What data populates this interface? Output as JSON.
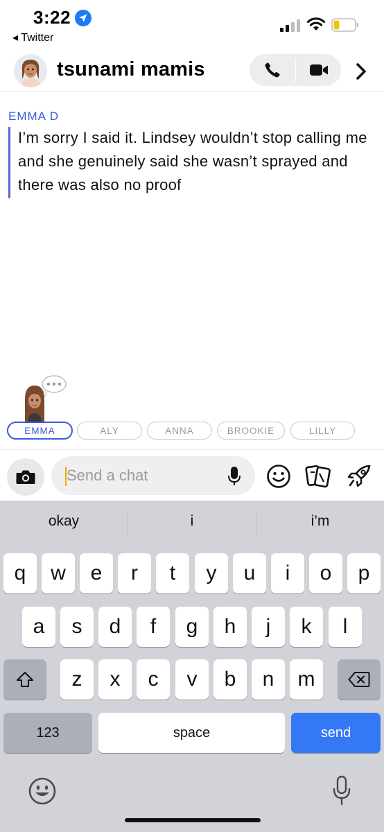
{
  "status_bar": {
    "time": "3:22",
    "back_app": "Twitter"
  },
  "header": {
    "title": "tsunami mamis"
  },
  "message": {
    "sender": "EMMA D",
    "text": "I’m sorry I said it. Lindsey wouldn’t stop calling me and she genuinely said she wasn’t sprayed and there was also no proof"
  },
  "members": [
    {
      "label": "EMMA",
      "active": true
    },
    {
      "label": "ALY",
      "active": false
    },
    {
      "label": "ANNA",
      "active": false
    },
    {
      "label": "BROOKIE",
      "active": false
    },
    {
      "label": "LILLY",
      "active": false
    }
  ],
  "chat_input": {
    "placeholder": "Send a chat"
  },
  "keyboard": {
    "suggestions": [
      "okay",
      "i",
      "i’m"
    ],
    "row1": [
      "q",
      "w",
      "e",
      "r",
      "t",
      "y",
      "u",
      "i",
      "o",
      "p"
    ],
    "row2": [
      "a",
      "s",
      "d",
      "f",
      "g",
      "h",
      "j",
      "k",
      "l"
    ],
    "row3": [
      "z",
      "x",
      "c",
      "v",
      "b",
      "n",
      "m"
    ],
    "numbers_label": "123",
    "space_label": "space",
    "send_label": "send"
  },
  "colors": {
    "accent_blue": "#3b5bdb",
    "send_blue": "#3478f6",
    "keyboard_bg": "#d1d3d8",
    "caret": "#f0a800"
  }
}
